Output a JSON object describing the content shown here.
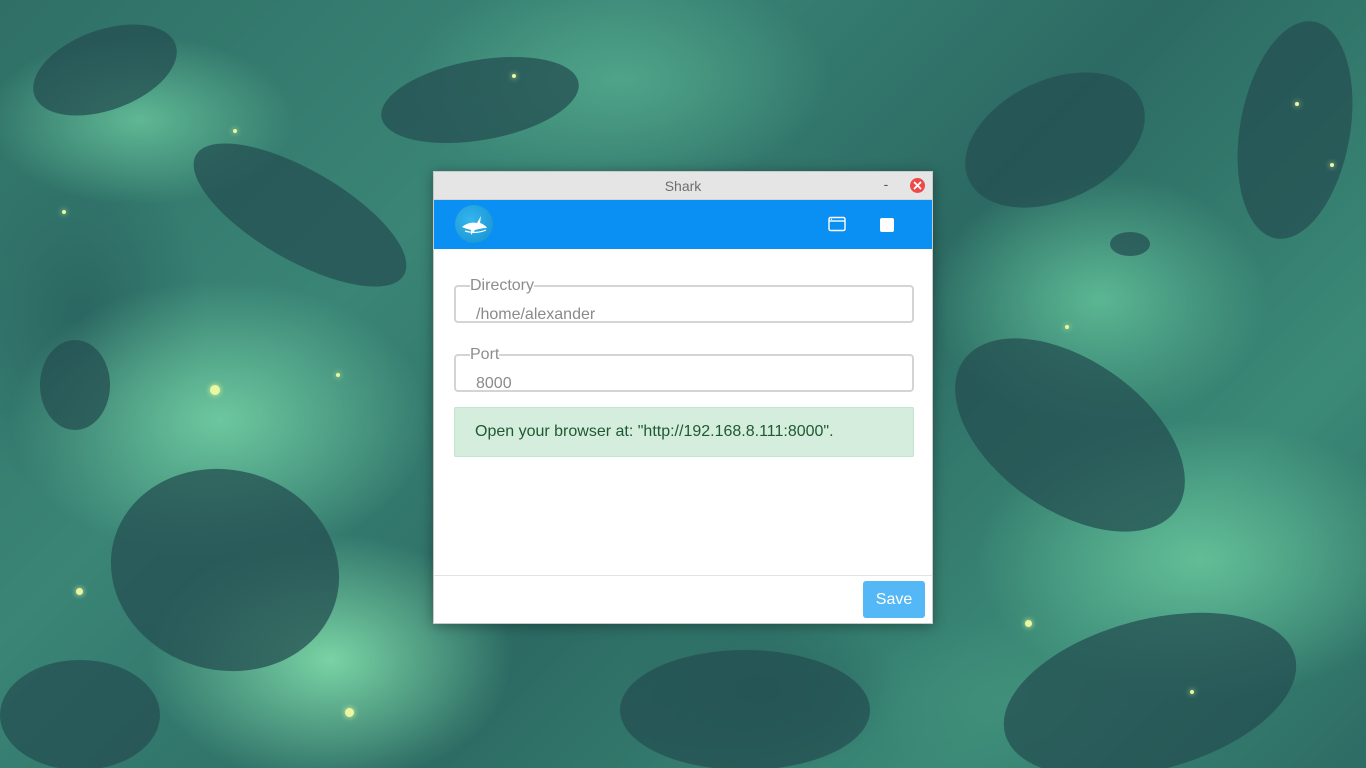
{
  "window": {
    "title": "Shark",
    "minimize_label": "-",
    "minimize_icon": "minimize-icon",
    "close_icon": "close-icon"
  },
  "header": {
    "logo_icon": "shark-logo-icon",
    "browser_icon": "browser-window-icon",
    "stop_icon": "stop-icon",
    "accent_color": "#0a8ff2"
  },
  "form": {
    "directory": {
      "label": "Directory",
      "value": "/home/alexander"
    },
    "port": {
      "label": "Port",
      "value": "8000"
    }
  },
  "alert": {
    "message": "Open your browser at: \"http://192.168.8.111:8000\".",
    "background_color": "#d5eddd",
    "text_color": "#1e5a2f"
  },
  "footer": {
    "save_label": "Save",
    "save_color": "#55b8f6"
  }
}
